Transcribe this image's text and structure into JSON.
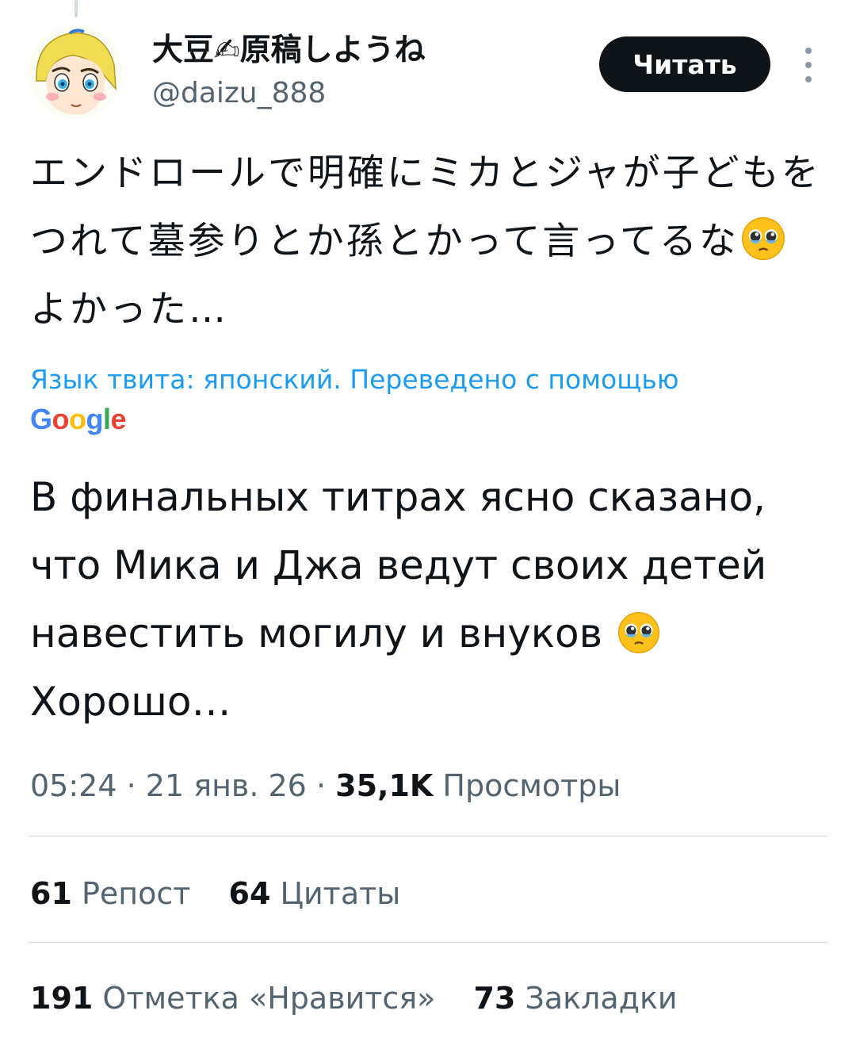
{
  "author": {
    "display_name": "大豆✍原稿しようね",
    "handle": "@daizu_888"
  },
  "follow_label": "Читать",
  "tweet": {
    "original_part1": "エンドロールで明確にミカとジャが子どもをつれて墓参りとか孫とかって言ってるな",
    "original_part2": "よかった…",
    "translation_note": "Язык твита: японский. Переведено с помощью",
    "translation_provider": "Google",
    "translated_part1": "В финальных титрах ясно сказано, что Мика и Джа ведут своих детей навестить могилу и внуков ",
    "translated_part2": "Хорошо…",
    "emoji": "pleading-face-with-tears"
  },
  "meta": {
    "time": "05:24",
    "date": "21 янв. 26",
    "separator": "·",
    "views_count": "35,1K",
    "views_label": "Просмотры"
  },
  "stats": {
    "reposts_count": "61",
    "reposts_label": "Репост",
    "quotes_count": "64",
    "quotes_label": "Цитаты",
    "likes_count": "191",
    "likes_label": "Отметка «Нравится»",
    "bookmarks_count": "73",
    "bookmarks_label": "Закладки"
  },
  "colors": {
    "link_blue": "#1d9bf0",
    "secondary_text": "#536471",
    "primary_text": "#0f1419",
    "divider": "#cfd9de",
    "google_blue": "#4285f4",
    "google_red": "#ea4335",
    "google_yellow": "#fbbc05",
    "google_green": "#34a853"
  }
}
